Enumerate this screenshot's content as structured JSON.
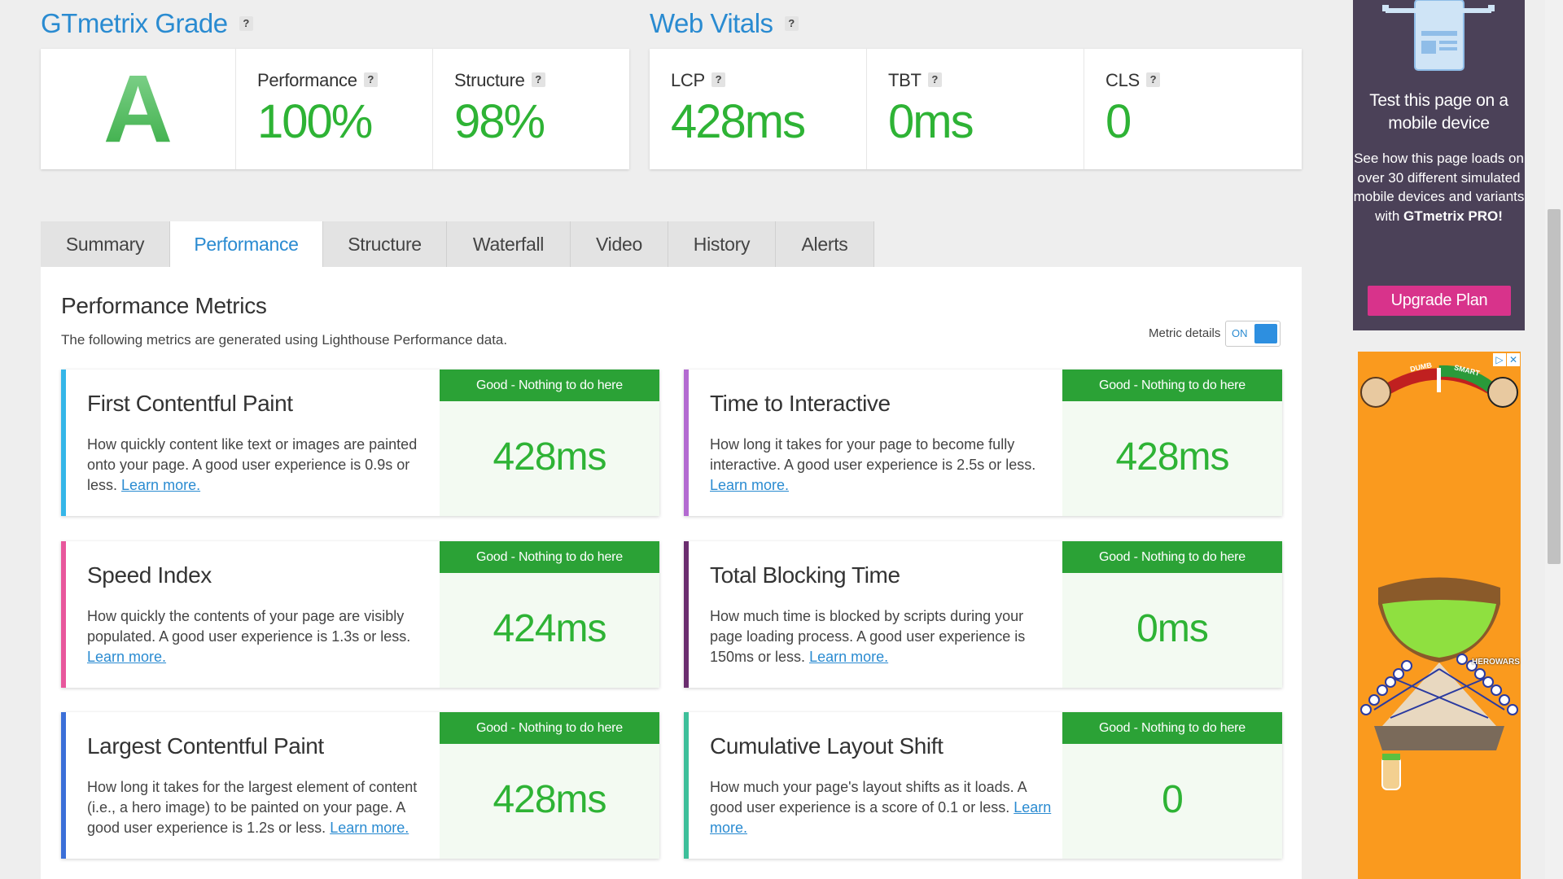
{
  "grade_section": {
    "title": "GTmetrix Grade",
    "help": "?",
    "grade": "A",
    "performance_label": "Performance",
    "performance_value": "100%",
    "structure_label": "Structure",
    "structure_value": "98%"
  },
  "vitals_section": {
    "title": "Web Vitals",
    "help": "?",
    "lcp_label": "LCP",
    "lcp_value": "428ms",
    "tbt_label": "TBT",
    "tbt_value": "0ms",
    "cls_label": "CLS",
    "cls_value": "0"
  },
  "tabs": [
    {
      "label": "Summary"
    },
    {
      "label": "Performance"
    },
    {
      "label": "Structure"
    },
    {
      "label": "Waterfall"
    },
    {
      "label": "Video"
    },
    {
      "label": "History"
    },
    {
      "label": "Alerts"
    }
  ],
  "active_tab": "Performance",
  "performance": {
    "title": "Performance Metrics",
    "description": "The following metrics are generated using Lighthouse Performance data.",
    "metric_details_label": "Metric details",
    "toggle_state": "ON"
  },
  "metrics": [
    {
      "name": "First Contentful Paint",
      "desc": "How quickly content like text or images are painted onto your page. A good user experience is 0.9s or less.",
      "link": "Learn more.",
      "badge": "Good - Nothing to do here",
      "value": "428ms",
      "accent": "#35b6e8"
    },
    {
      "name": "Time to Interactive",
      "desc": "How long it takes for your page to become fully interactive. A good user experience is 2.5s or less.",
      "link": "Learn more.",
      "badge": "Good - Nothing to do here",
      "value": "428ms",
      "accent": "#b36ad1"
    },
    {
      "name": "Speed Index",
      "desc": "How quickly the contents of your page are visibly populated. A good user experience is 1.3s or less.",
      "link": "Learn more.",
      "badge": "Good - Nothing to do here",
      "value": "424ms",
      "accent": "#e8579c"
    },
    {
      "name": "Total Blocking Time",
      "desc": "How much time is blocked by scripts during your page loading process. A good user experience is 150ms or less.",
      "link": "Learn more.",
      "badge": "Good - Nothing to do here",
      "value": "0ms",
      "accent": "#6a2d6e"
    },
    {
      "name": "Largest Contentful Paint",
      "desc": "How long it takes for the largest element of content (i.e., a hero image) to be painted on your page. A good user experience is 1.2s or less.",
      "link": "Learn more.",
      "badge": "Good - Nothing to do here",
      "value": "428ms",
      "accent": "#3b6fd8"
    },
    {
      "name": "Cumulative Layout Shift",
      "desc": "How much your page's layout shifts as it loads. A good user experience is a score of 0.1 or less.",
      "link": "Learn more.",
      "badge": "Good - Nothing to do here",
      "value": "0",
      "accent": "#3dbf9a"
    }
  ],
  "promo": {
    "title": "Test this page on a mobile device",
    "text": "See how this page loads on over 30 different simulated mobile devices and variants with",
    "brand": "GTmetrix PRO!",
    "button": "Upgrade Plan"
  },
  "ad": {
    "label_left": "DUMB",
    "label_right": "SMART",
    "brand": "HEROWARS"
  },
  "colors": {
    "accent_blue": "#2a8bd1",
    "good_green": "#2eb335",
    "badge_green": "#2ba236",
    "upgrade_pink": "#d8338b",
    "promo_bg": "#4b4158",
    "ad_bg": "#fa9a1e"
  }
}
